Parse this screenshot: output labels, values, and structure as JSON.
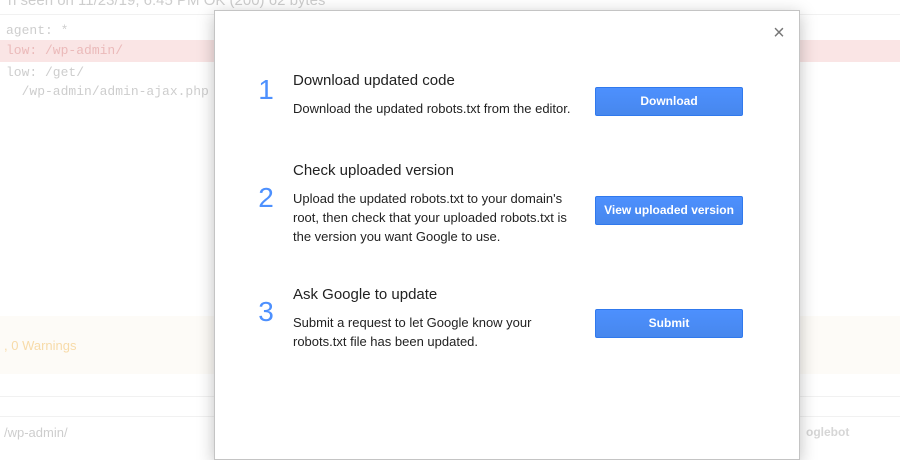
{
  "background": {
    "header_text": "n seen on 11/23/19, 6:45 PM OK (200) 62 bytes",
    "code_lines": [
      "agent: *",
      "low: /wp-admin/",
      "low: /get/",
      "  /wp-admin/admin-ajax.php"
    ],
    "warnings_text": ", 0 Warnings",
    "path_text": "/wp-admin/",
    "agent_text": "oglebot"
  },
  "modal": {
    "close_glyph": "×",
    "steps": [
      {
        "number": "1",
        "title": "Download updated code",
        "description": "Download the updated robots.txt from the editor.",
        "button": "Download"
      },
      {
        "number": "2",
        "title": "Check uploaded version",
        "description": "Upload the updated robots.txt to your domain's root, then check that your uploaded robots.txt is the version you want Google to use.",
        "button": "View uploaded version"
      },
      {
        "number": "3",
        "title": "Ask Google to update",
        "description": "Submit a request to let Google know your robots.txt file has been updated.",
        "button": "Submit"
      }
    ]
  },
  "colors": {
    "accent": "#4d90fe",
    "error_row": "#f9dcdc",
    "warning_text": "#f5cf8d"
  }
}
